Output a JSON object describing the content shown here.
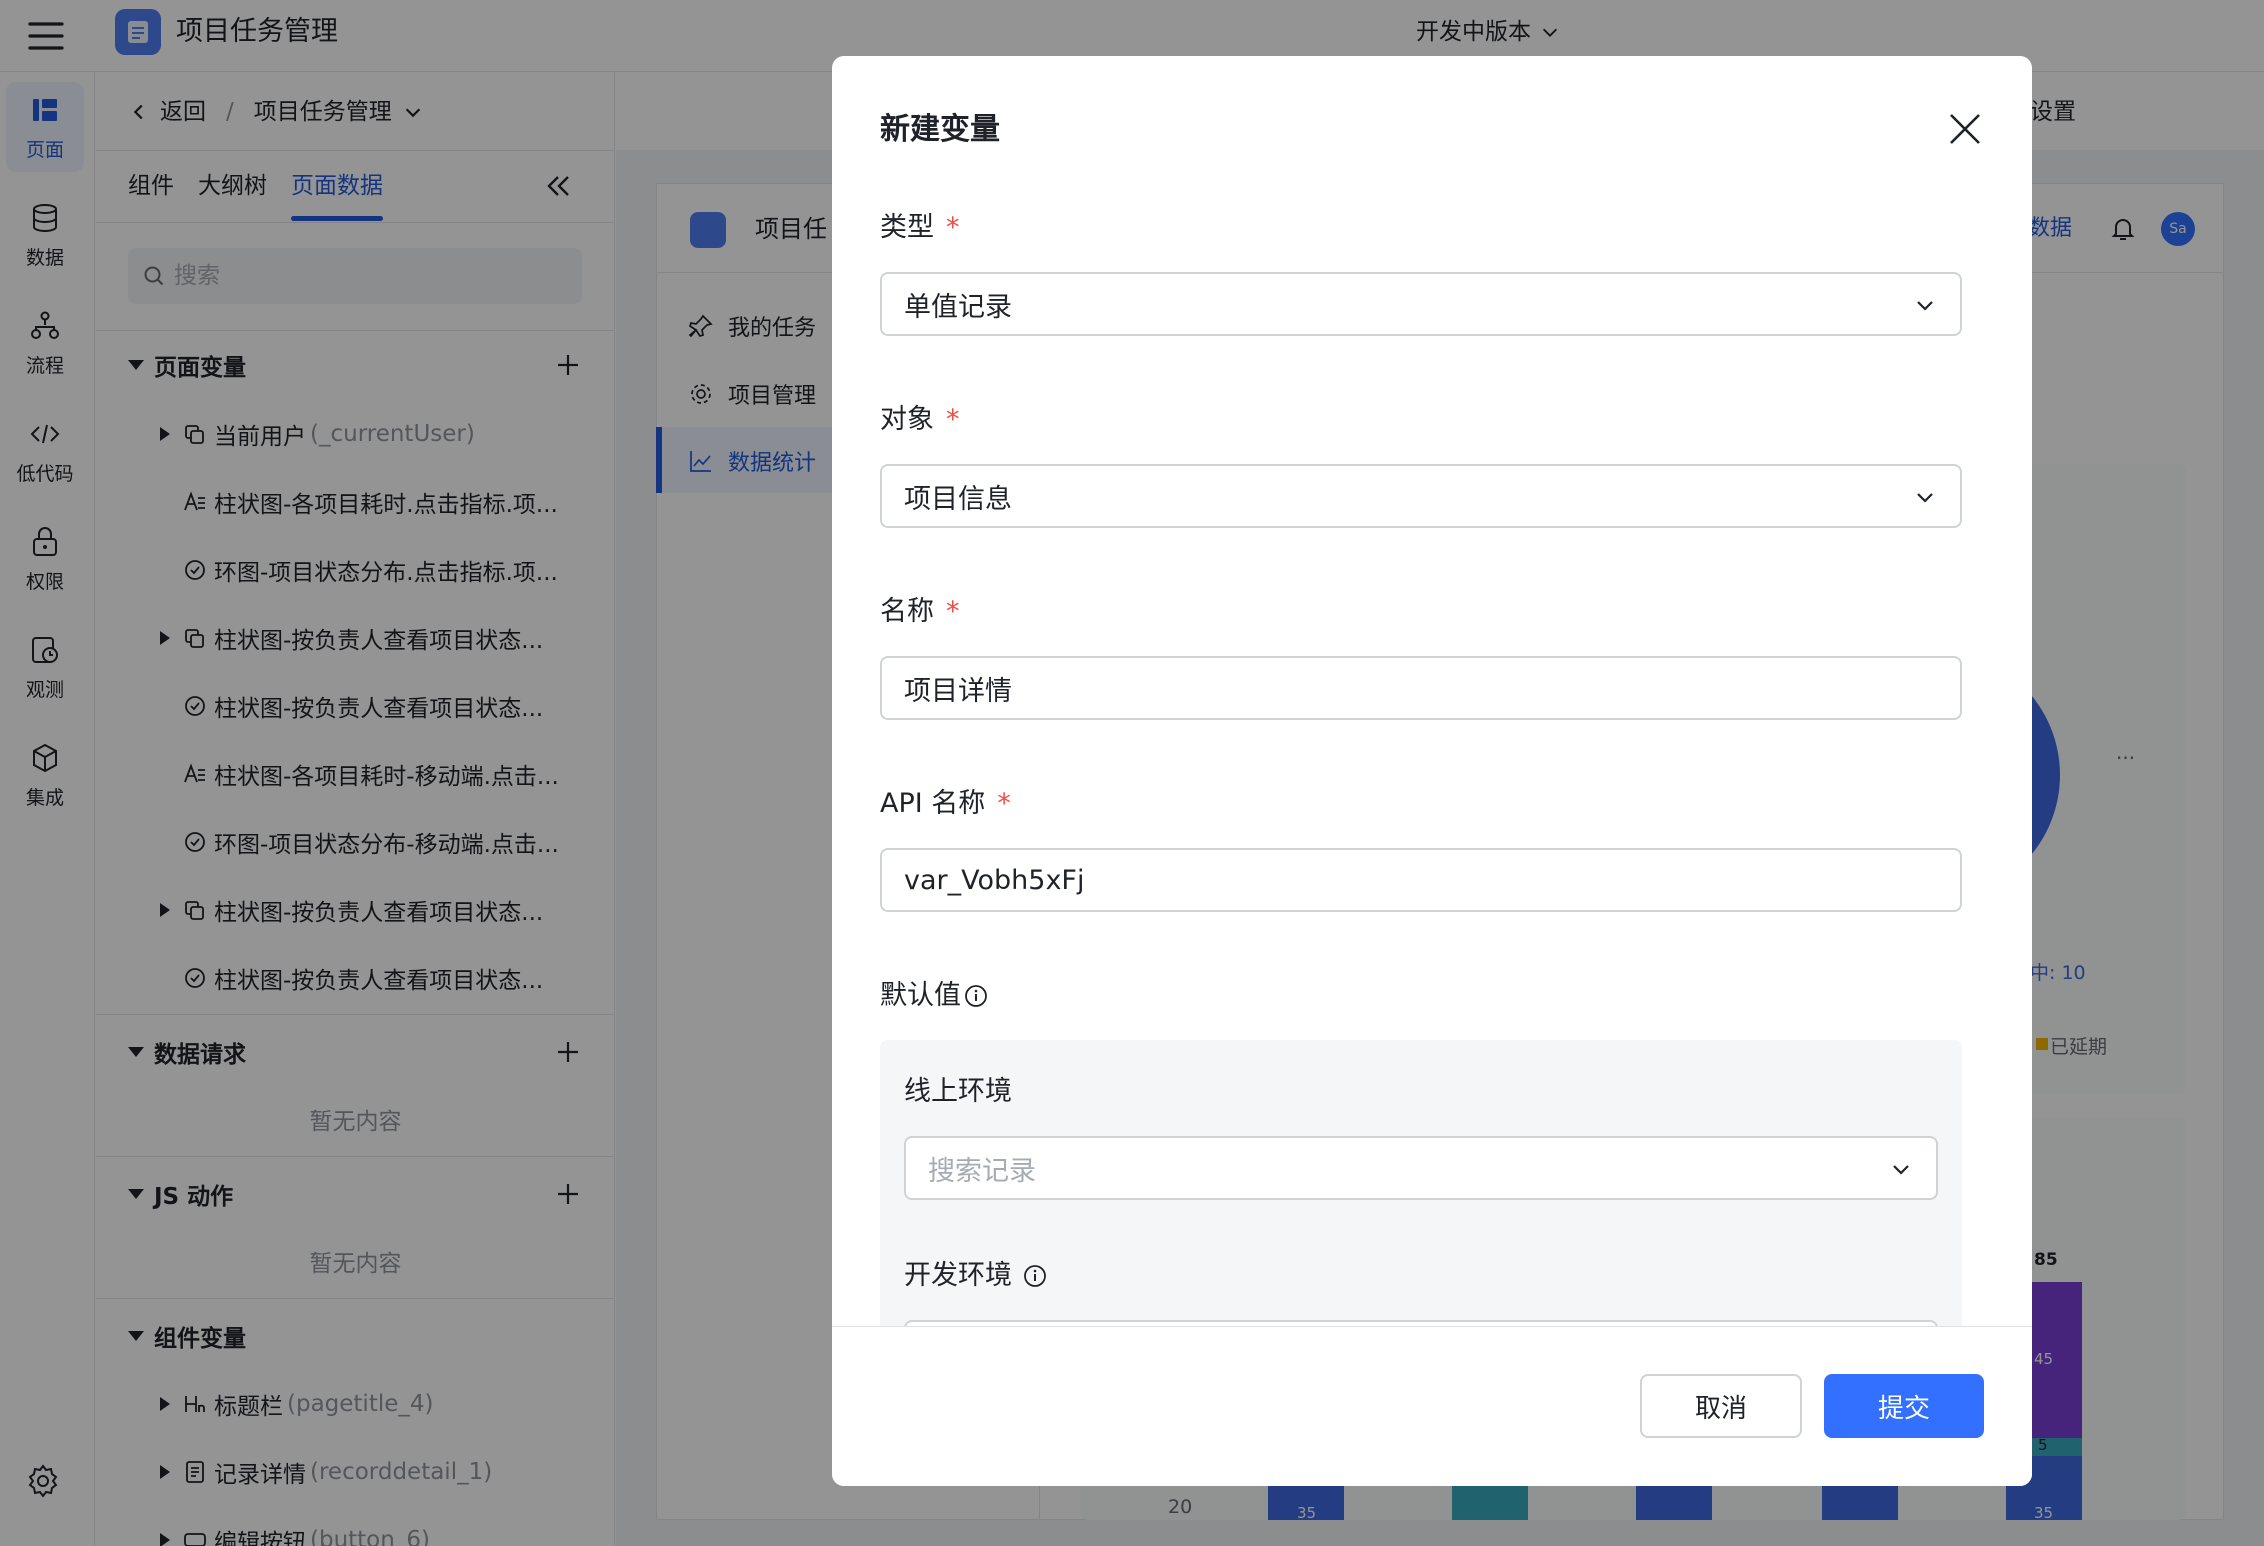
{
  "app": {
    "title": "项目任务管理",
    "version_label": "开发中版本"
  },
  "rail": {
    "items": [
      {
        "label": "页面"
      },
      {
        "label": "数据"
      },
      {
        "label": "流程"
      },
      {
        "label": "低代码"
      },
      {
        "label": "权限"
      },
      {
        "label": "观测"
      },
      {
        "label": "集成"
      }
    ]
  },
  "breadcrumb": {
    "back": "返回",
    "separator": "/",
    "current": "项目任务管理"
  },
  "panel": {
    "tabs": [
      "组件",
      "大纲树",
      "页面数据"
    ],
    "search_placeholder": "搜索",
    "sections": {
      "page_vars": {
        "title": "页面变量",
        "items": [
          {
            "label": "当前用户",
            "api": "(_currentUser)"
          },
          {
            "label": "柱状图-各项目耗时.点击指标.项..."
          },
          {
            "label": "环图-项目状态分布.点击指标.项..."
          },
          {
            "label": "柱状图-按负责人查看项目状态..."
          },
          {
            "label": "柱状图-按负责人查看项目状态..."
          },
          {
            "label": "柱状图-各项目耗时-移动端.点击..."
          },
          {
            "label": "环图-项目状态分布-移动端.点击..."
          },
          {
            "label": "柱状图-按负责人查看项目状态..."
          },
          {
            "label": "柱状图-按负责人查看项目状态..."
          }
        ]
      },
      "data_requests": {
        "title": "数据请求",
        "empty": "暂无内容"
      },
      "js_actions": {
        "title": "JS 动作",
        "empty": "暂无内容"
      },
      "component_vars": {
        "title": "组件变量",
        "items": [
          {
            "label": "标题栏",
            "api": "(pagetitle_4)"
          },
          {
            "label": "记录详情",
            "api": "(recorddetail_1)"
          },
          {
            "label": "编辑按钮",
            "api": "(button_6)"
          }
        ]
      }
    }
  },
  "canvas": {
    "topbar_right": "设置",
    "preview_title": "项目任",
    "header_link": "数据",
    "avatar": "Sa",
    "nav": [
      "我的任务",
      "项目管理",
      "数据统计"
    ],
    "chart_fragments": {
      "pie_label": "中: 10",
      "legend_item": "已延期",
      "ellipsis": "...",
      "axis_tick": "20",
      "bar_labels": [
        "85",
        "45",
        "5",
        "35",
        "35"
      ]
    }
  },
  "modal": {
    "title": "新建变量",
    "fields": {
      "type": {
        "label": "类型",
        "value": "单值记录"
      },
      "object": {
        "label": "对象",
        "value": "项目信息"
      },
      "name": {
        "label": "名称",
        "value": "项目详情"
      },
      "api_name": {
        "label": "API 名称",
        "value": "var_Vobh5xFj"
      }
    },
    "default_value": {
      "label": "默认值",
      "online_env": {
        "label": "线上环境",
        "placeholder": "搜索记录"
      },
      "dev_env": {
        "label": "开发环境"
      }
    },
    "required_mark": "*",
    "cancel_label": "取消",
    "submit_label": "提交"
  },
  "colors": {
    "primary": "#3370ff",
    "active_text": "#245bdb",
    "required": "#f54a45"
  }
}
